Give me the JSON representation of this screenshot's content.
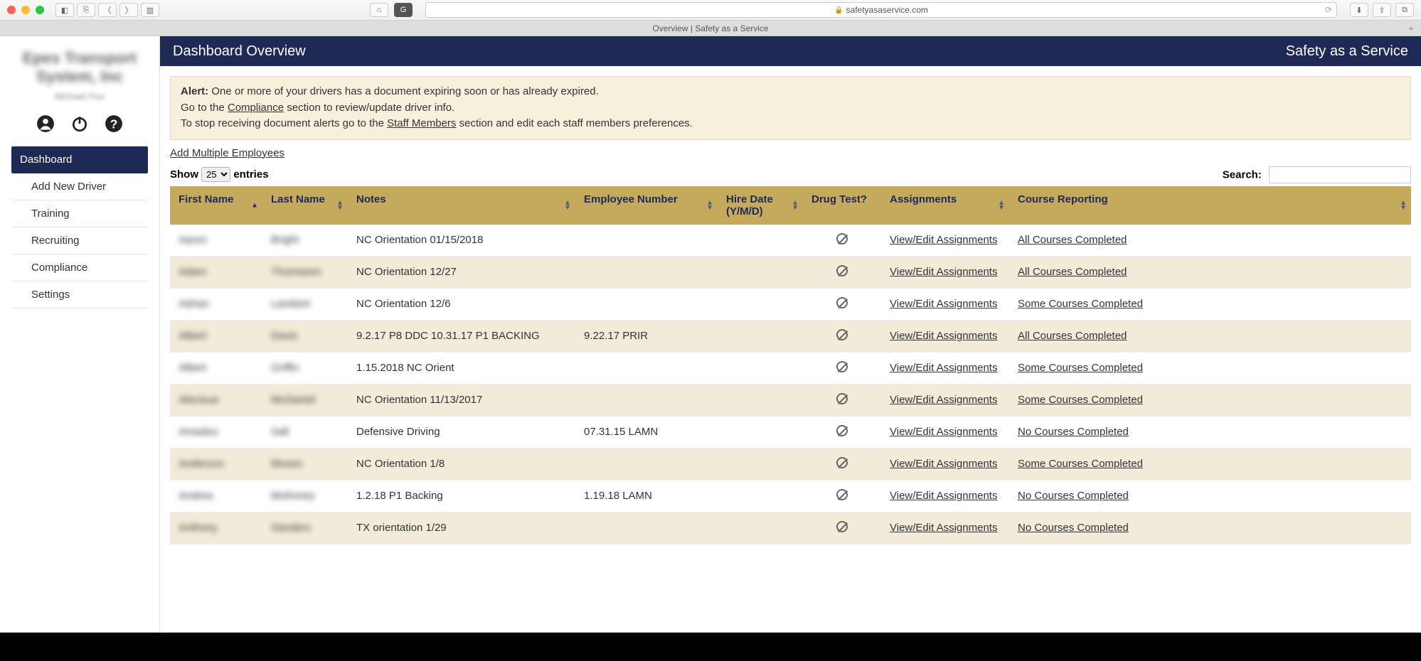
{
  "browser": {
    "url_host": "safetyasaservice.com",
    "tab_title": "Overview | Safety as a Service"
  },
  "sidebar": {
    "company_name": "Epes Transport System, Inc",
    "user_name": "Michael Fox",
    "nav": [
      {
        "label": "Dashboard",
        "active": true
      },
      {
        "label": "Add New Driver",
        "sub": true
      },
      {
        "label": "Training",
        "sub": true
      },
      {
        "label": "Recruiting",
        "sub": true
      },
      {
        "label": "Compliance",
        "sub": true
      },
      {
        "label": "Settings",
        "sub": true
      }
    ]
  },
  "header": {
    "title": "Dashboard Overview",
    "brand": "Safety as a Service"
  },
  "alert": {
    "label": "Alert:",
    "line1_rest": " One or more of your drivers has a document expiring soon or has already expired.",
    "line2_pre": "Go to the ",
    "compliance_link": "Compliance",
    "line2_post": " section to review/update driver info.",
    "line3_pre": "To stop receiving document alerts go to the ",
    "staff_link": "Staff Members",
    "line3_post": " section and edit each staff members preferences."
  },
  "links": {
    "add_multiple": "Add Multiple Employees"
  },
  "table_ctrl": {
    "show_label": "Show",
    "entries_label": "entries",
    "page_size": "25",
    "search_label": "Search:"
  },
  "columns": {
    "first": "First Name",
    "last": "Last Name",
    "notes": "Notes",
    "emp": "Employee Number",
    "hire": "Hire Date (Y/M/D)",
    "drug": "Drug Test?",
    "assign": "Assignments",
    "course": "Course Reporting"
  },
  "row_labels": {
    "view_edit": "View/Edit Assignments"
  },
  "rows": [
    {
      "first": "Aaron",
      "last": "Bright",
      "notes": "NC Orientation 01/15/2018",
      "emp": "",
      "hire": "",
      "course": "All Courses Completed"
    },
    {
      "first": "Adam",
      "last": "Thomason",
      "notes": "NC Orientation 12/27",
      "emp": "",
      "hire": "",
      "course": "All Courses Completed"
    },
    {
      "first": "Adrian",
      "last": "Lambert",
      "notes": "NC Orientation 12/6",
      "emp": "",
      "hire": "",
      "course": "Some Courses Completed"
    },
    {
      "first": "Albert",
      "last": "Davis",
      "notes": "9.2.17 P8 DDC 10.31.17 P1 BACKING",
      "emp": "9.22.17 PRIR",
      "hire": "",
      "course": "All Courses Completed"
    },
    {
      "first": "Albert",
      "last": "Griffin",
      "notes": "1.15.2018 NC Orient",
      "emp": "",
      "hire": "",
      "course": "Some Courses Completed"
    },
    {
      "first": "Alecisue",
      "last": "McDaniel",
      "notes": "NC Orientation 11/13/2017",
      "emp": "",
      "hire": "",
      "course": "Some Courses Completed"
    },
    {
      "first": "Amadou",
      "last": "Sall",
      "notes": "Defensive Driving",
      "emp": "07.31.15 LAMN",
      "hire": "",
      "course": "No Courses Completed"
    },
    {
      "first": "Anderson",
      "last": "Moses",
      "notes": "NC Orientation 1/8",
      "emp": "",
      "hire": "",
      "course": "Some Courses Completed"
    },
    {
      "first": "Andrea",
      "last": "Mulroney",
      "notes": "1.2.18 P1 Backing",
      "emp": "1.19.18 LAMN",
      "hire": "",
      "course": "No Courses Completed"
    },
    {
      "first": "Anthony",
      "last": "Sanders",
      "notes": "TX orientation 1/29",
      "emp": "",
      "hire": "",
      "course": "No Courses Completed"
    }
  ]
}
